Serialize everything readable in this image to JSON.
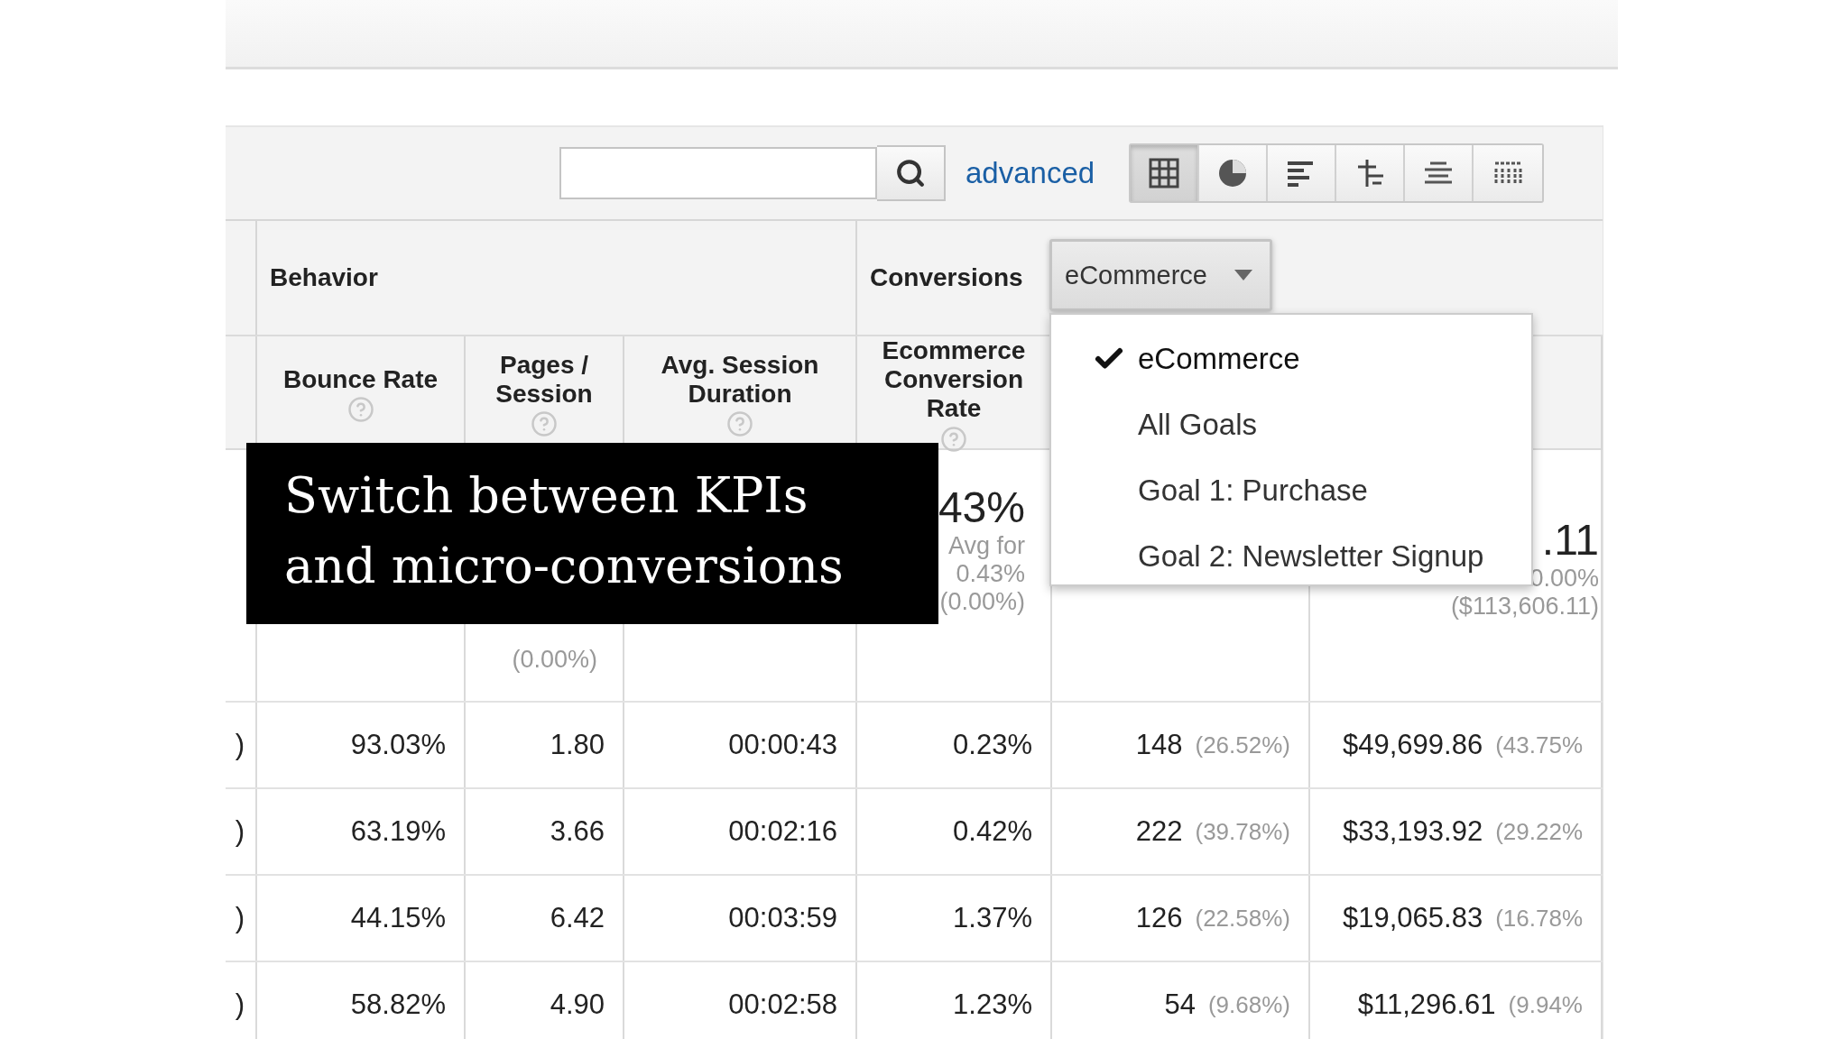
{
  "toolbar": {
    "advanced_link": "advanced",
    "view_buttons": [
      {
        "kind": "grid",
        "selected": true
      },
      {
        "kind": "pie",
        "selected": false
      },
      {
        "kind": "bars",
        "selected": false
      },
      {
        "kind": "compare",
        "selected": false
      },
      {
        "kind": "pivot",
        "selected": false
      },
      {
        "kind": "cloud",
        "selected": false
      }
    ]
  },
  "groups": [
    {
      "label": "Behavior"
    },
    {
      "label": "Conversions"
    }
  ],
  "conversion_dropdown": {
    "value": "eCommerce",
    "expanded": true,
    "options": [
      {
        "label": "eCommerce",
        "selected": true
      },
      {
        "label": "All Goals",
        "selected": false
      },
      {
        "label": "Goal 1: Purchase",
        "selected": false
      },
      {
        "label": "Goal 2: Newsletter Signup",
        "selected": false
      }
    ]
  },
  "columns": [
    {
      "label": "Bounce Rate"
    },
    {
      "label": "Pages / Session"
    },
    {
      "label": "Avg. Session Duration"
    },
    {
      "label": "Ecommerce Conversion Rate"
    }
  ],
  "summary": {
    "pages_session": [
      "(0.00%)"
    ],
    "conversion_rate": [
      "43%",
      "Avg for",
      "0.43%",
      "(0.00%)"
    ],
    "column_6": [
      ".11",
      "0.00%",
      "($113,606.11)"
    ]
  },
  "rows": [
    {
      "cells": [
        {
          "value": ")"
        },
        {
          "value": "93.03%"
        },
        {
          "value": "1.80"
        },
        {
          "value": "00:00:43"
        },
        {
          "value": "0.23%"
        },
        {
          "value": "148",
          "share": "(26.52%)"
        },
        {
          "value": "$49,699.86",
          "share": "(43.75%"
        }
      ]
    },
    {
      "cells": [
        {
          "value": ")"
        },
        {
          "value": "63.19%"
        },
        {
          "value": "3.66"
        },
        {
          "value": "00:02:16"
        },
        {
          "value": "0.42%"
        },
        {
          "value": "222",
          "share": "(39.78%)"
        },
        {
          "value": "$33,193.92",
          "share": "(29.22%"
        }
      ]
    },
    {
      "cells": [
        {
          "value": ")"
        },
        {
          "value": "44.15%"
        },
        {
          "value": "6.42"
        },
        {
          "value": "00:03:59"
        },
        {
          "value": "1.37%"
        },
        {
          "value": "126",
          "share": "(22.58%)"
        },
        {
          "value": "$19,065.83",
          "share": "(16.78%"
        }
      ]
    },
    {
      "cells": [
        {
          "value": ")"
        },
        {
          "value": "58.82%"
        },
        {
          "value": "4.90"
        },
        {
          "value": "00:02:58"
        },
        {
          "value": "1.23%"
        },
        {
          "value": "54",
          "share": "(9.68%)"
        },
        {
          "value": "$11,296.61",
          "share": "(9.94%"
        }
      ]
    }
  ],
  "caption": "Switch between KPIs\nand micro-conversions"
}
